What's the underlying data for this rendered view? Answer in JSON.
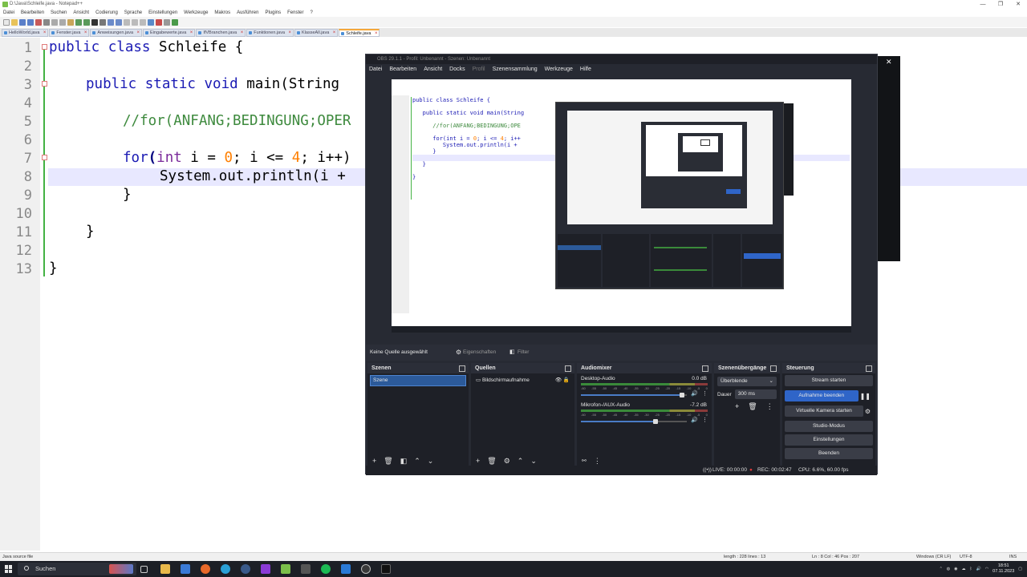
{
  "notepad": {
    "title": "D:\\Java\\Schleife.java - Notepad++",
    "menu": [
      "Datei",
      "Bearbeiten",
      "Suchen",
      "Ansicht",
      "Codierung",
      "Sprache",
      "Einstellungen",
      "Werkzeuge",
      "Makros",
      "Ausführen",
      "Plugins",
      "Fenster",
      "?"
    ],
    "tabs": [
      "HelloWorld.java",
      "Fenster.java",
      "Anweisungen.java",
      "Eingabewerte.java",
      "IfVBranchen.java",
      "Funktionen.java",
      "KlasseAll.java",
      "Schleife.java"
    ],
    "active_tab": 7,
    "line_numbers": [
      "1",
      "2",
      "3",
      "4",
      "5",
      "6",
      "7",
      "8",
      "9",
      "10",
      "11",
      "12",
      "13"
    ],
    "code": {
      "l1_kw": "public class",
      "l1_rest": " Schleife {",
      "l3_kw": "public static void",
      "l3_rest": " main(String",
      "l5": "//for(ANFANG;BEDINGUNG;OPER",
      "l7_kw": "for",
      "l7_a": "(",
      "l7_type": "int",
      "l7_b": " i = ",
      "l7_n0": "0",
      "l7_c": "; i <= ",
      "l7_n4": "4",
      "l7_d": "; i++)",
      "l8": "System.out.println(i +",
      "l9": "}",
      "l11": "}",
      "l13": "}"
    },
    "status": {
      "file_type": "Java source file",
      "length_lines": "length : 228    lines : 13",
      "position": "Ln : 8    Col : 46    Pos : 207",
      "eol": "Windows (CR LF)",
      "encoding": "UTF-8",
      "mode": "INS"
    }
  },
  "obs": {
    "title": "OBS 29.1.1 - Profil: Unbenannt - Szenen: Unbenannt",
    "menu": [
      "Datei",
      "Bearbeiten",
      "Ansicht",
      "Docks",
      "Profil",
      "Szenensammlung",
      "Werkzeuge",
      "Hilfe"
    ],
    "toolbar": {
      "no_source": "Keine Quelle ausgewählt",
      "properties": "Eigenschaften",
      "filter": "Filter"
    },
    "scenes": {
      "header": "Szenen",
      "items": [
        "Szene"
      ]
    },
    "sources": {
      "header": "Quellen",
      "items": [
        "Bildschirmaufnahme"
      ]
    },
    "mixer": {
      "header": "Audiomixer",
      "channels": [
        {
          "name": "Desktop-Audio",
          "db": "0.0 dB",
          "level": 0.95
        },
        {
          "name": "Mikrofon-/AUX-Audio",
          "db": "-7.2 dB",
          "level": 0.7
        }
      ],
      "ticks": [
        "-60",
        "-55",
        "-50",
        "-45",
        "-40",
        "-35",
        "-30",
        "-25",
        "-20",
        "-15",
        "-10",
        "-5",
        "0"
      ]
    },
    "transitions": {
      "header": "Szenenübergänge",
      "selected": "Überblende",
      "duration_label": "Dauer",
      "duration": "300 ms"
    },
    "controls": {
      "header": "Steuerung",
      "buttons": [
        "Stream starten",
        "Aufnahme beenden",
        "Virtuelle Kamera starten",
        "Studio-Modus",
        "Einstellungen",
        "Beenden"
      ]
    },
    "status": {
      "live": "LIVE: 00:00:00",
      "rec": "REC: 00:02:47",
      "cpu": "CPU: 6.6%, 60.00 fps"
    }
  },
  "taskbar": {
    "search": "Suchen",
    "time": "18:51",
    "date": "07.11.2023"
  },
  "colors": {
    "keyword": "#1b1bb4",
    "comment": "#3e8a3e",
    "number": "#ff7f00",
    "obs_bg": "#272a33",
    "obs_accent": "#2f65c8",
    "fold_bar": "#43b243"
  }
}
